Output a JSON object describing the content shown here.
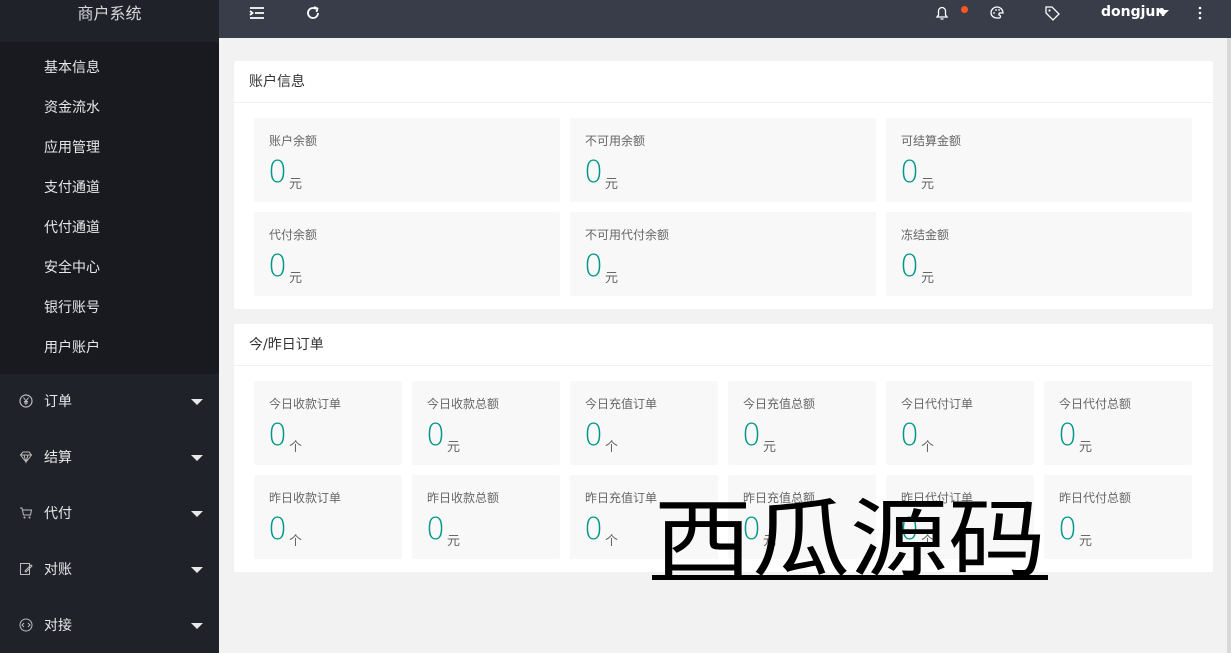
{
  "sidebar": {
    "title": "商户系统",
    "sub_items": [
      "基本信息",
      "资金流水",
      "应用管理",
      "支付通道",
      "代付通道",
      "安全中心",
      "银行账号",
      "用户账户"
    ],
    "menu_items": [
      {
        "label": "订单",
        "icon": "yen-icon"
      },
      {
        "label": "结算",
        "icon": "diamond-icon"
      },
      {
        "label": "代付",
        "icon": "cart-icon"
      },
      {
        "label": "对账",
        "icon": "edit-icon"
      },
      {
        "label": "对接",
        "icon": "code-icon"
      }
    ]
  },
  "header": {
    "username": "dongjun",
    "icons": [
      "menu-icon",
      "refresh-icon",
      "bell-icon",
      "palette-icon",
      "tag-icon",
      "more-icon"
    ]
  },
  "account": {
    "title": "账户信息",
    "stats": [
      {
        "label": "账户余额",
        "value": "0",
        "unit": "元"
      },
      {
        "label": "不可用余额",
        "value": "0",
        "unit": "元"
      },
      {
        "label": "可结算金额",
        "value": "0",
        "unit": "元"
      },
      {
        "label": "代付余额",
        "value": "0",
        "unit": "元"
      },
      {
        "label": "不可用代付余额",
        "value": "0",
        "unit": "元"
      },
      {
        "label": "冻结金额",
        "value": "0",
        "unit": "元"
      }
    ]
  },
  "orders": {
    "title": "今/昨日订单",
    "stats": [
      {
        "label": "今日收款订单",
        "value": "0",
        "unit": "个"
      },
      {
        "label": "今日收款总额",
        "value": "0",
        "unit": "元"
      },
      {
        "label": "今日充值订单",
        "value": "0",
        "unit": "个"
      },
      {
        "label": "今日充值总额",
        "value": "0",
        "unit": "元"
      },
      {
        "label": "今日代付订单",
        "value": "0",
        "unit": "个"
      },
      {
        "label": "今日代付总额",
        "value": "0",
        "unit": "元"
      },
      {
        "label": "昨日收款订单",
        "value": "0",
        "unit": "个"
      },
      {
        "label": "昨日收款总额",
        "value": "0",
        "unit": "元"
      },
      {
        "label": "昨日充值订单",
        "value": "0",
        "unit": "个"
      },
      {
        "label": "昨日充值总额",
        "value": "0",
        "unit": "元"
      },
      {
        "label": "昨日代付订单",
        "value": "0",
        "unit": "个"
      },
      {
        "label": "昨日代付总额",
        "value": "0",
        "unit": "元"
      }
    ]
  },
  "watermark": {
    "text": "西瓜源码"
  },
  "colors": {
    "accent": "#009688",
    "header": "#393d49",
    "sidebar": "#20222a",
    "badge": "#ff5722"
  }
}
